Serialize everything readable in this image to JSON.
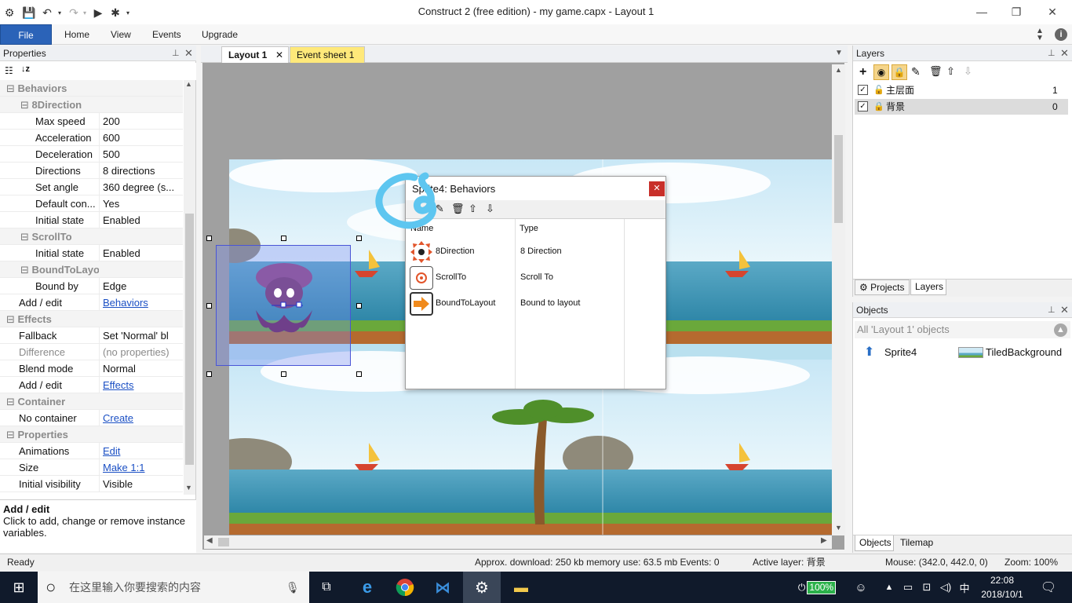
{
  "window": {
    "title": "Construct 2  (free edition) - my game.capx - Layout 1"
  },
  "ribbon": {
    "tabs": [
      "File",
      "Home",
      "View",
      "Events",
      "Upgrade"
    ]
  },
  "properties": {
    "title": "Properties",
    "rows": [
      {
        "type": "category",
        "key": "Behaviors",
        "expanded": true,
        "indent": 0
      },
      {
        "type": "category",
        "key": "8Direction",
        "expanded": true,
        "indent": 1
      },
      {
        "type": "prop",
        "key": "Max speed",
        "value": "200",
        "indent": 2
      },
      {
        "type": "prop",
        "key": "Acceleration",
        "value": "600",
        "indent": 2
      },
      {
        "type": "prop",
        "key": "Deceleration",
        "value": "500",
        "indent": 2
      },
      {
        "type": "prop",
        "key": "Directions",
        "value": "8 directions",
        "indent": 2
      },
      {
        "type": "prop",
        "key": "Set angle",
        "value": "360 degree (s...",
        "indent": 2
      },
      {
        "type": "prop",
        "key": "Default con...",
        "value": "Yes",
        "indent": 2
      },
      {
        "type": "prop",
        "key": "Initial state",
        "value": "Enabled",
        "indent": 2
      },
      {
        "type": "category",
        "key": "ScrollTo",
        "expanded": true,
        "indent": 1
      },
      {
        "type": "prop",
        "key": "Initial state",
        "value": "Enabled",
        "indent": 2
      },
      {
        "type": "category",
        "key": "BoundToLayout",
        "expanded": true,
        "indent": 1
      },
      {
        "type": "prop",
        "key": "Bound by",
        "value": "Edge",
        "indent": 2
      },
      {
        "type": "prop",
        "key": "Add / edit",
        "value": "Behaviors",
        "link": true,
        "indent": 1
      },
      {
        "type": "category",
        "key": "Effects",
        "expanded": true,
        "indent": 0
      },
      {
        "type": "prop",
        "key": "Fallback",
        "value": "Set 'Normal' bl",
        "indent": 1
      },
      {
        "type": "prop",
        "key": "Difference",
        "value": "(no properties)",
        "gray": true,
        "indent": 1
      },
      {
        "type": "prop",
        "key": "Blend mode",
        "value": "Normal",
        "indent": 1
      },
      {
        "type": "prop",
        "key": "Add / edit",
        "value": "Effects",
        "link": true,
        "indent": 1
      },
      {
        "type": "category",
        "key": "Container",
        "expanded": true,
        "indent": 0
      },
      {
        "type": "prop",
        "key": "No container",
        "value": "Create",
        "link": true,
        "indent": 1
      },
      {
        "type": "category",
        "key": "Properties",
        "expanded": true,
        "indent": 0
      },
      {
        "type": "prop",
        "key": "Animations",
        "value": "Edit",
        "link": true,
        "indent": 1
      },
      {
        "type": "prop",
        "key": "Size",
        "value": "Make 1:1",
        "link": true,
        "indent": 1
      },
      {
        "type": "prop",
        "key": "Initial visibility",
        "value": "Visible",
        "indent": 1
      }
    ],
    "description": {
      "title": "Add / edit",
      "text": "Click to add, change or remove instance variables."
    }
  },
  "editor": {
    "tabs": [
      {
        "label": "Layout 1",
        "active": true
      },
      {
        "label": "Event sheet 1",
        "active": false
      }
    ]
  },
  "behaviors_dialog": {
    "title": "Sprite4: Behaviors",
    "columns": [
      "Name",
      "Type"
    ],
    "rows": [
      {
        "name": "8Direction",
        "type": "8 Direction",
        "icon": "8direction-icon"
      },
      {
        "name": "ScrollTo",
        "type": "Scroll To",
        "icon": "scrollto-icon"
      },
      {
        "name": "BoundToLayout",
        "type": "Bound to layout",
        "icon": "boundtolayout-icon"
      }
    ]
  },
  "layers": {
    "title": "Layers",
    "rows": [
      {
        "name": "主层面",
        "index": "1",
        "visible": true,
        "locked": false
      },
      {
        "name": "背景",
        "index": "0",
        "visible": true,
        "locked": true
      }
    ],
    "tabs": [
      "Projects",
      "Layers"
    ]
  },
  "objects": {
    "title": "Objects",
    "filter": "All 'Layout 1' objects",
    "items": [
      {
        "name": "Sprite4",
        "icon": "sprite-icon"
      },
      {
        "name": "TiledBackground",
        "icon": "tiled-background-icon"
      }
    ],
    "tabs": [
      "Objects",
      "Tilemap"
    ]
  },
  "statusbar": {
    "ready": "Ready",
    "download": "Approx. download: 250 kb  memory use: 63.5 mb  Events: 0",
    "active_layer": "Active layer: 背景",
    "mouse": "Mouse: (342.0, 442.0, 0)",
    "zoom": "Zoom: 100%"
  },
  "taskbar": {
    "search_placeholder": "在这里输入你要搜索的内容",
    "battery": "100%",
    "ime": "中",
    "time": "22:08",
    "date": "2018/10/1"
  },
  "colors": {
    "file_tab": "#2b63b8",
    "event_tab": "#ffe97a",
    "selection": "#4a55d6",
    "annotation": "#5ec6f0",
    "taskbar": "#101a2b"
  }
}
